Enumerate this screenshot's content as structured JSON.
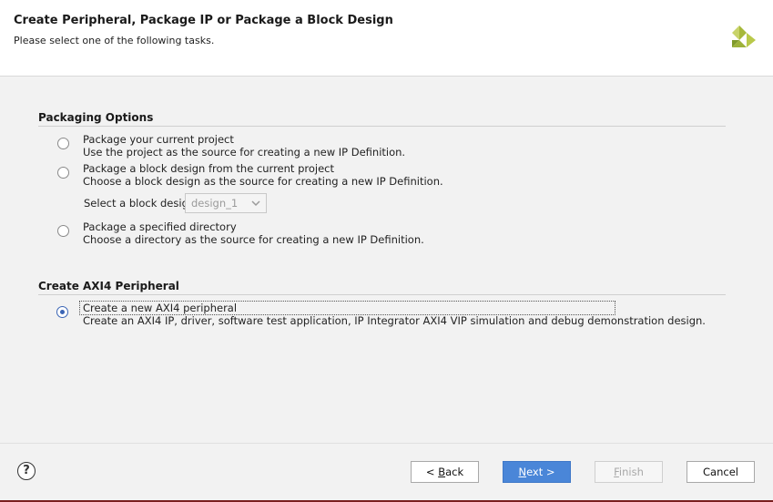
{
  "header": {
    "title": "Create Peripheral, Package IP or Package a Block Design",
    "subtitle": "Please select one of the following tasks."
  },
  "sections": {
    "packaging": {
      "title": "Packaging Options",
      "options": [
        {
          "title": "Package your current project",
          "desc": "Use the project as the source for creating a new IP Definition.",
          "selected": false
        },
        {
          "title": "Package a block design from the current project",
          "desc": "Choose a block design as the source for creating a new IP Definition.",
          "selected": false
        },
        {
          "title": "Package a specified directory",
          "desc": "Choose a directory as the source for creating a new IP Definition.",
          "selected": false
        }
      ],
      "block_design": {
        "label": "Select a block design:",
        "value": "design_1"
      }
    },
    "axi": {
      "title": "Create AXI4 Peripheral",
      "option": {
        "title": "Create a new AXI4 peripheral",
        "desc": "Create an AXI4 IP, driver, software test application, IP Integrator AXI4 VIP simulation and debug demonstration design.",
        "selected": true
      }
    }
  },
  "footer": {
    "help_label": "?",
    "back": {
      "mnemonic": "B",
      "rest": "ack",
      "prefix": "< "
    },
    "next": {
      "mnemonic": "N",
      "rest": "ext >"
    },
    "finish": {
      "mnemonic": "F",
      "rest": "inish"
    },
    "cancel_label": "Cancel"
  },
  "colors": {
    "accent": "#4a86d8",
    "radio_selected": "#3b65b5",
    "logo": "#9db23a"
  },
  "icons": {
    "logo": "xilinx-logo-icon",
    "chevron": "chevron-down-icon",
    "help": "help-icon"
  }
}
